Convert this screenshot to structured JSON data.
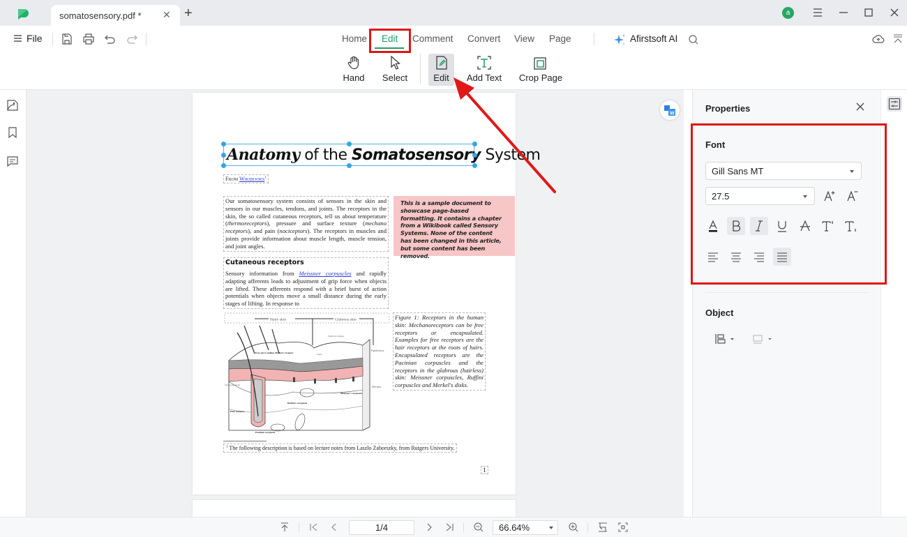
{
  "app": {
    "tab_title": "somatosensory.pdf *",
    "avatar_letter": "a",
    "colors": {
      "accent": "#1f9d6a",
      "highlight": "#dd1616",
      "selection": "#30a6e8",
      "callout_bg": "#f7c6c6"
    }
  },
  "toolbar": {
    "file_label": "File",
    "menu_tabs": [
      {
        "label": "Home",
        "active": false
      },
      {
        "label": "Edit",
        "active": true
      },
      {
        "label": "Comment",
        "active": false
      },
      {
        "label": "Convert",
        "active": false
      },
      {
        "label": "View",
        "active": false
      },
      {
        "label": "Page",
        "active": false
      }
    ],
    "ai_label": "Afirstsoft AI",
    "tools": [
      {
        "label": "Hand",
        "icon": "hand-icon"
      },
      {
        "label": "Select",
        "icon": "cursor-icon"
      },
      {
        "label": "Edit",
        "icon": "edit-document-icon",
        "active": true
      },
      {
        "label": "Add Text",
        "icon": "add-text-icon"
      },
      {
        "label": "Crop Page",
        "icon": "crop-icon"
      }
    ]
  },
  "document": {
    "title_parts": [
      "Anatomy",
      " of the ",
      "Somatosensory",
      " System"
    ],
    "from_prefix": "From ",
    "from_link": "Wikibooks",
    "from_sup": "1",
    "intro_paragraph_parts": [
      "Our somatosensory system consists of sensors in the skin and sensors in our muscles, tendons, and joints. The receptors in the skin, the so called cutaneous receptors, tell us about temperature (",
      "thermoreceptors",
      "), pressure and surface texture (",
      "mechano receptors",
      "), and pain (",
      "nociceptors",
      "). The receptors in muscles and joints provide information about muscle length, muscle tension, and joint angles."
    ],
    "callout": "This is a sample document to showcase page-based formatting. It contains a chapter from a Wikibook called Sensory Systems. None of the content has been changed in this article, but some content has been removed.",
    "section_heading": "Cutaneous receptors",
    "section_paragraph_parts": [
      "Sensory information from ",
      "Meissner corpuscles",
      " and rapidly adapting afferents leads to adjustment of grip force when objects are lifted. These afferents respond with a brief burst of action potentials when objects move a small distance during the early stages of lifting. In response to"
    ],
    "figure_caption": "Figure 1: Receptors in the human skin: Mechanoreceptors can be free receptors or encapsulated. Examples for free receptors are the hair receptors at the roots of hairs. Encapsulated receptors are the Pacinian corpuscles and the receptors in the glabrous (hairless) skin: Meissner corpuscles, Ruffini corpuscles and Merkel's disks.",
    "figure_labels": {
      "hairy_skin": "Hairy skin",
      "glabrous_skin": "Glabrous skin",
      "papillary_ridges": "Papillary Ridges",
      "epidermis": "Epidermis",
      "dermis": "Dermis",
      "free_nerve": "Free nerve ending",
      "merkel": "Merkel's receptor",
      "septa": "Septa",
      "sebaceous": "Sebaceous gland",
      "ruffini": "Ruffini's corpuscle",
      "meissner": "Meissner's corpuscle",
      "hair_receptor": "Hair receptor",
      "pacinian": "Pacinian corpuscle"
    },
    "footnote_mark": "1",
    "footnote": "The following description is based on lecture notes from Laszlo Zaborszky, from Rutgers University.",
    "page_number": "1"
  },
  "properties": {
    "title": "Properties",
    "font_section": "Font",
    "font_family": "Gill Sans MT",
    "font_size": "27.5",
    "format_buttons": [
      {
        "name": "font-color",
        "active": false
      },
      {
        "name": "bold",
        "active": true
      },
      {
        "name": "italic",
        "active": true
      },
      {
        "name": "underline",
        "active": false
      },
      {
        "name": "strikethrough",
        "active": false
      },
      {
        "name": "superscript",
        "active": false
      },
      {
        "name": "subscript",
        "active": false
      }
    ],
    "alignment": {
      "selected": "justify",
      "options": [
        "left",
        "center",
        "right",
        "justify"
      ]
    },
    "object_section": "Object"
  },
  "bottombar": {
    "page_indicator": "1/4",
    "zoom_level": "66.64%"
  }
}
